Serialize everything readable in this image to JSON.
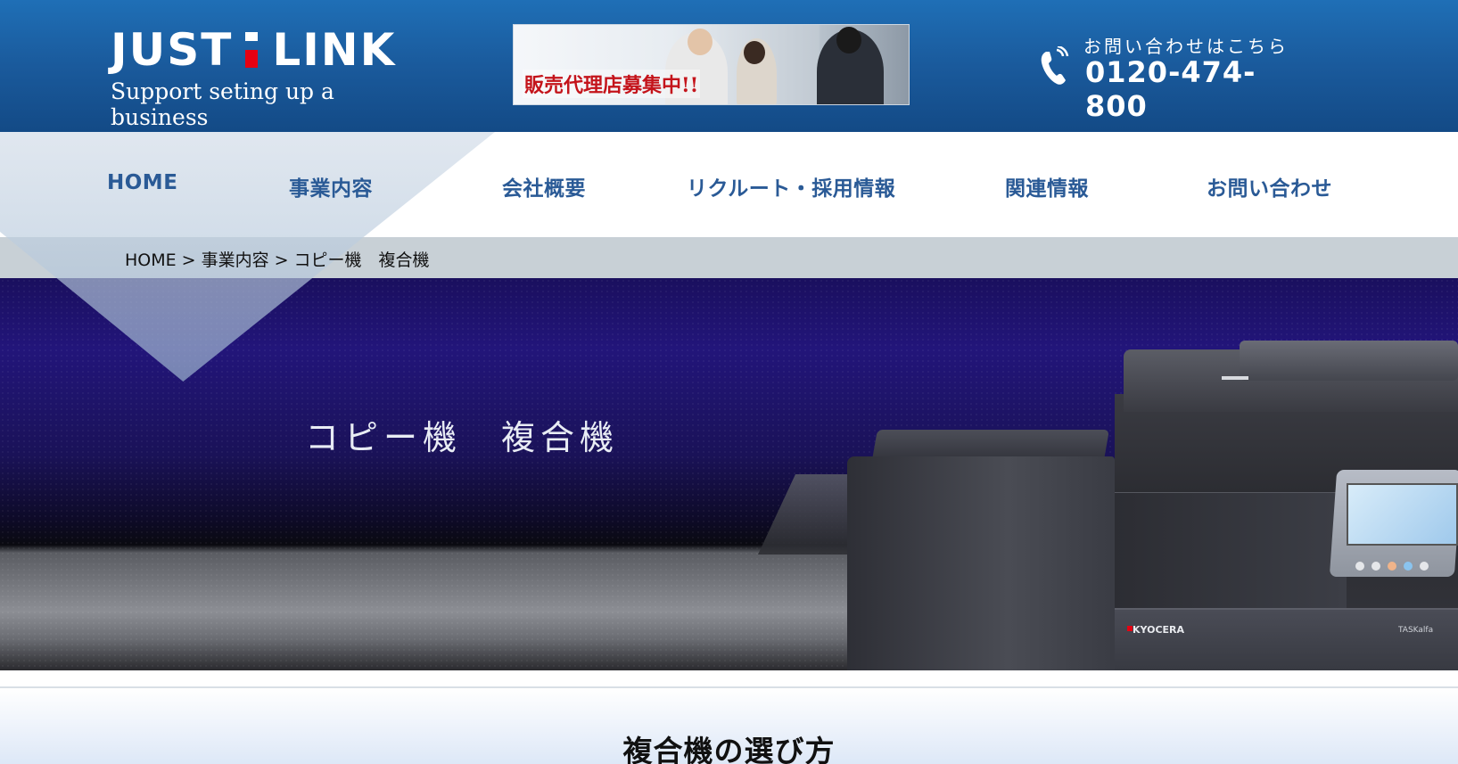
{
  "header": {
    "logo_main_left": "JUST",
    "logo_main_right": "LINK",
    "logo_sub": "Support seting up a business",
    "banner_text": "販売代理店募集中!!",
    "contact_label": "お問い合わせはこちら",
    "contact_number": "0120-474-800",
    "colors": {
      "header_bg": "#1a5a9c",
      "logo_accent": "#e60012",
      "banner_text": "#c4141b"
    }
  },
  "nav": {
    "items": [
      {
        "label": "HOME"
      },
      {
        "label": "事業内容"
      },
      {
        "label": "会社概要"
      },
      {
        "label": "リクルート・採用情報"
      },
      {
        "label": "関連情報"
      },
      {
        "label": "お問い合わせ"
      }
    ],
    "color": "#2a5a96"
  },
  "breadcrumb": {
    "items": [
      "HOME",
      "事業内容",
      "コピー機　複合機"
    ],
    "separator": ">"
  },
  "hero": {
    "title": "コピー機　複合機",
    "copier_brand": "KYOCERA",
    "copier_model": "TASKalfa"
  },
  "section": {
    "title": "複合機の選び方"
  },
  "icons": {
    "phone": "phone-icon"
  }
}
